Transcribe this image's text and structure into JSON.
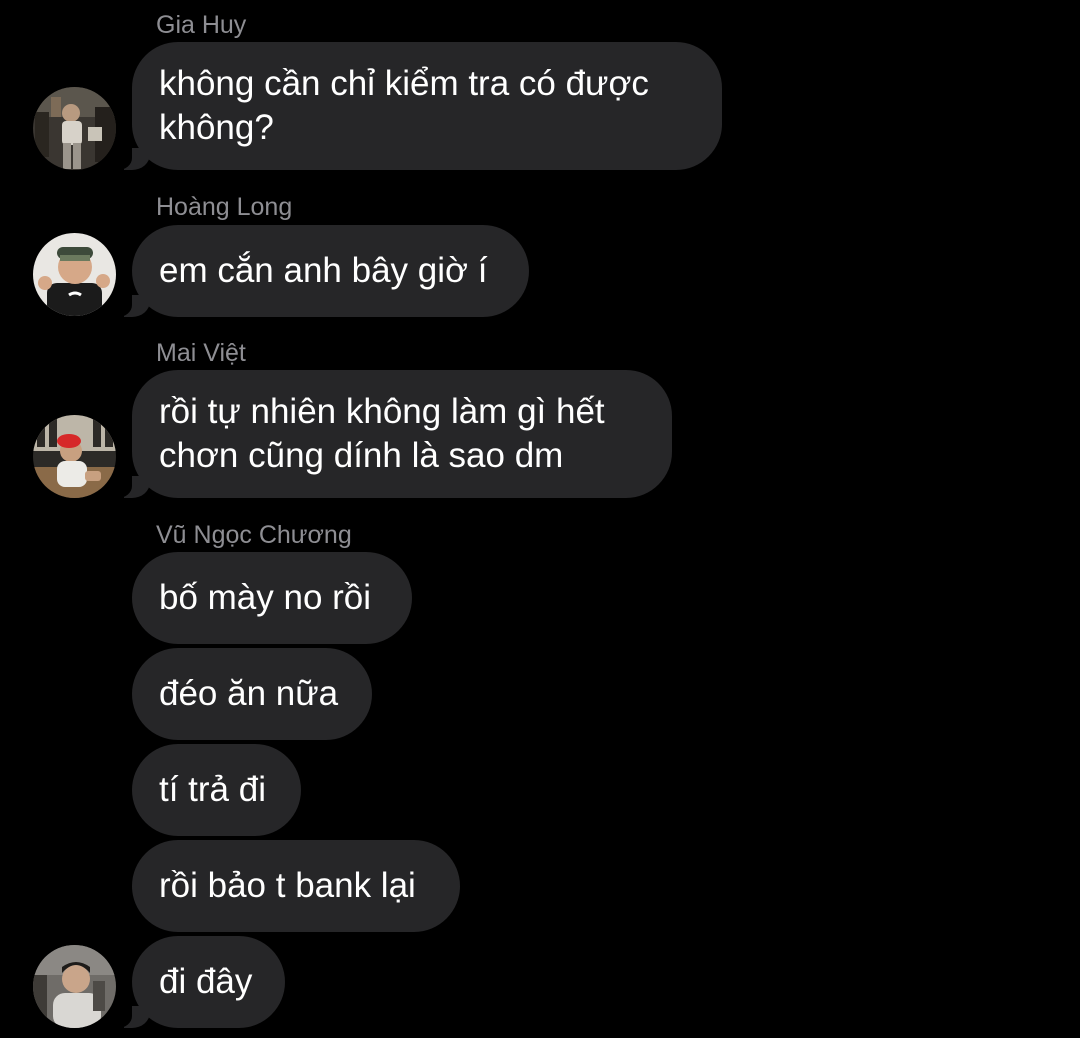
{
  "messages": [
    {
      "sender": "Gia Huy",
      "text_lines": [
        "không cần chỉ kiểm tra có được",
        "không?"
      ]
    },
    {
      "sender": "Hoàng Long",
      "text": "em cắn anh bây giờ í"
    },
    {
      "sender": "Mai Việt",
      "text_lines": [
        "rồi tự nhiên không làm gì hết",
        "chơn cũng dính là sao dm"
      ]
    },
    {
      "sender": "Vũ Ngọc Chương",
      "texts": [
        "bố mày no rồi",
        "đéo ăn nữa",
        "tí trả đi",
        "rồi bảo t bank lại",
        "đi đây"
      ]
    }
  ],
  "colors": {
    "background": "#000000",
    "bubble": "#262628",
    "sender_name": "#8e8e93",
    "text": "#ffffff"
  },
  "avatars": [
    "avatar-gia-huy",
    "avatar-hoang-long",
    "avatar-mai-viet",
    "avatar-vu-ngoc-chuong"
  ]
}
